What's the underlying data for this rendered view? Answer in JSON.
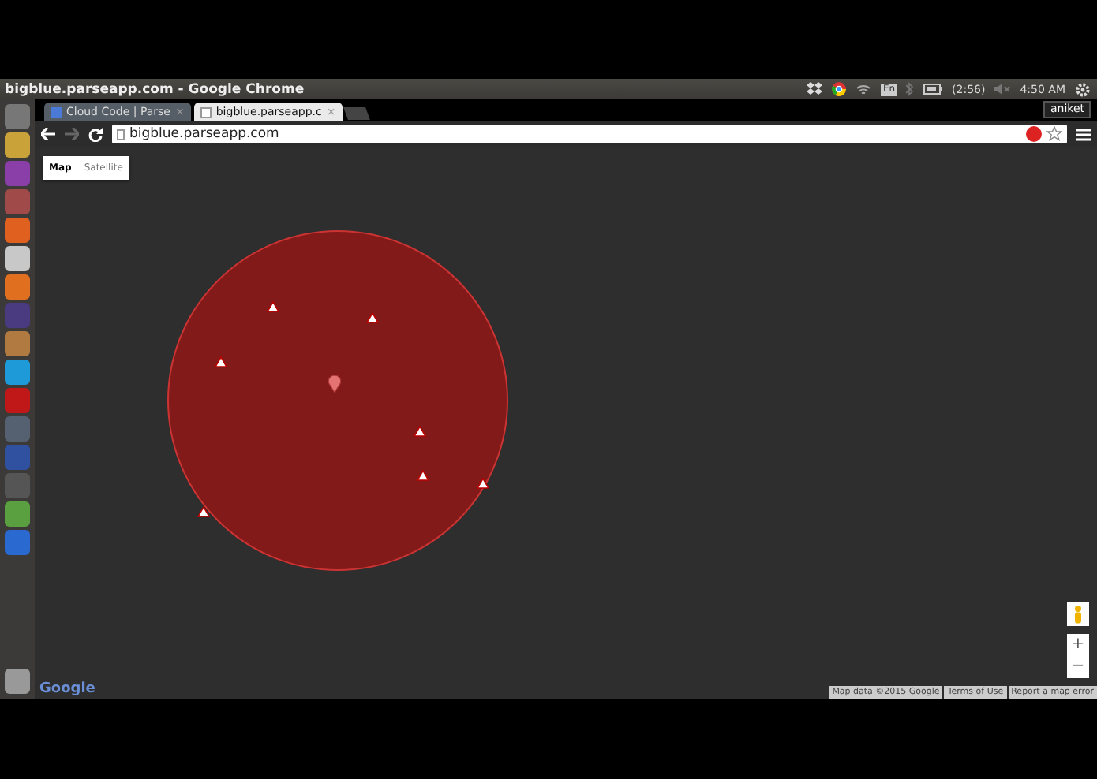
{
  "window": {
    "title": "bigblue.parseapp.com - Google Chrome"
  },
  "tray": {
    "keyboard": "En",
    "battery": "(2:56)",
    "time": "4:50 AM"
  },
  "tabs": [
    {
      "label": "Cloud Code | Parse",
      "close": "×",
      "selected": false
    },
    {
      "label": "bigblue.parseapp.c",
      "close": "×",
      "selected": true
    }
  ],
  "user": "aniket",
  "address_bar": {
    "url": "bigblue.parseapp.com"
  },
  "map": {
    "type_buttons": [
      {
        "label": "Map",
        "selected": true
      },
      {
        "label": "Satellite",
        "selected": false
      }
    ],
    "zoom_in": "+",
    "zoom_out": "−",
    "logo": "Google",
    "footer": [
      "Map data ©2015 Google",
      "Terms of Use",
      "Report a map error"
    ]
  }
}
